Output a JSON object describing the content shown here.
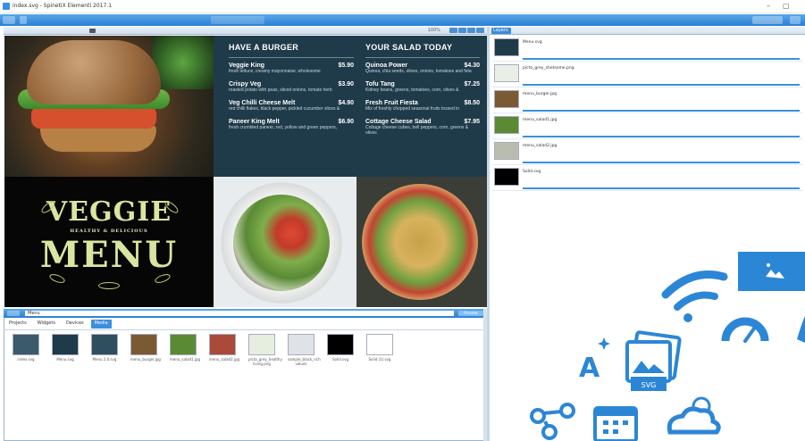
{
  "window": {
    "title": "index.svg - SpinetiX Elementi 2017.1",
    "minimize_glyph": "–",
    "maximize_glyph": "▢"
  },
  "canvas": {
    "zoom_label": "100%",
    "menu": {
      "left_title": "HAVE A BURGER",
      "right_title": "YOUR SALAD TODAY",
      "left_items": [
        {
          "name": "Veggie King",
          "price": "$5.90",
          "desc": "fresh lettuce, creamy mayonnaise, wholesome"
        },
        {
          "name": "Crispy Veg",
          "price": "$3.90",
          "desc": "roasted potato with peas, sliced onions, tomato herb"
        },
        {
          "name": "Veg Chilli Cheese Melt",
          "price": "$4.90",
          "desc": "red chilli flakes, black pepper, pickled cucumber slices &"
        },
        {
          "name": "Paneer King Melt",
          "price": "$6.90",
          "desc": "fresh crumbled paneer, red, yellow and green peppers,"
        }
      ],
      "right_items": [
        {
          "name": "Quinoa Power",
          "price": "$4.30",
          "desc": "Quinoa, chia seeds, olives, onions, tomatoes and feta"
        },
        {
          "name": "Tofu Tang",
          "price": "$7.25",
          "desc": "Kidney beans, greens, tomatoes, corn, olives &"
        },
        {
          "name": "Fresh Fruit Fiesta",
          "price": "$8.50",
          "desc": "Mix of freshly chopped seasonal fruits tossed in"
        },
        {
          "name": "Cottage Cheese Salad",
          "price": "$7.95",
          "desc": "Cottage cheese cubes, bell peppers, corn, greens & olives"
        }
      ],
      "veggie_word": "VEGGIE",
      "menu_word": "MENU",
      "healthy_word": "HEALTHY & DELICIOUS"
    }
  },
  "right_panel": {
    "tab_label": "Layers",
    "media": [
      {
        "name": "Menu.svg",
        "thumb_color": "#1f3b4a"
      },
      {
        "name": "picto_grey_shetsome.png",
        "thumb_color": "#e9efe6"
      },
      {
        "name": "menu_burger.jpg",
        "thumb_color": "#7a5a32"
      },
      {
        "name": "menu_salad1.jpg",
        "thumb_color": "#5a8a34"
      },
      {
        "name": "menu_salad2.jpg",
        "thumb_color": "#b9bdb0"
      },
      {
        "name": "Solid.svg",
        "thumb_color": "#000000"
      }
    ]
  },
  "bottom_panel": {
    "path": "Menu",
    "play_label": "Preview",
    "tabs": [
      "Projects",
      "Widgets",
      "Devices",
      "Media"
    ],
    "active_tab": "Media",
    "files": [
      {
        "name": "index.svg",
        "color": "#3b5a6b"
      },
      {
        "name": "Menu.svg",
        "color": "#1f3b4a"
      },
      {
        "name": "Menu 2.0.svg",
        "color": "#2f4f5e"
      },
      {
        "name": "menu_burger.jpg",
        "color": "#7a5a32"
      },
      {
        "name": "menu_salad1.jpg",
        "color": "#5a8a34"
      },
      {
        "name": "menu_salad2.jpg",
        "color": "#a94a3a"
      },
      {
        "name": "picto_grey_healthy living.png",
        "color": "#e6eee0"
      },
      {
        "name": "sample_black_rich values",
        "color": "#dfe3e8"
      },
      {
        "name": "Solid.svg",
        "color": "#000000"
      },
      {
        "name": "Solid (1).svg",
        "color": "#ffffff"
      }
    ]
  },
  "decor": {
    "svg_badge": "SVG",
    "font_letter": "A"
  }
}
